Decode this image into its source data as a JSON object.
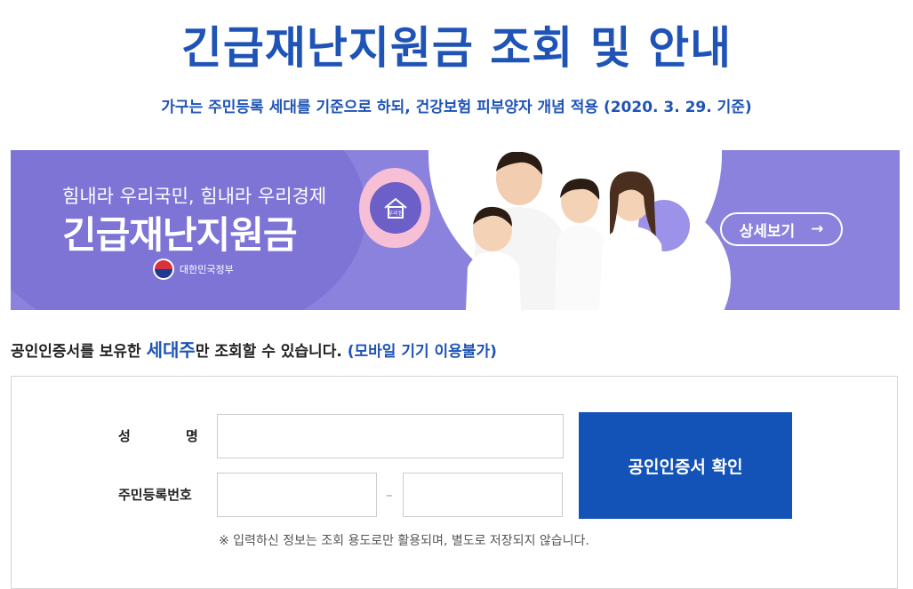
{
  "header": {
    "title": "긴급재난지원금 조회 및 안내",
    "subtitle": "가구는 주민등록 세대를 기준으로 하되, 건강보험 피부양자 개념 적용 (2020. 3. 29. 기준)"
  },
  "banner": {
    "slogan": "힘내라 우리국민, 힘내라 우리경제",
    "title": "긴급재난지원금",
    "gov_label": "대한민국정부",
    "detail_button": "상세보기",
    "detail_arrow": "→",
    "house_label": "우리집"
  },
  "notice": {
    "prefix": "공인인증서를 보유한 ",
    "highlight": "세대주",
    "middle": "만 조회할 수 있습니다. ",
    "mobile": "(모바일 기기 이용불가)"
  },
  "form": {
    "name_label_left": "성",
    "name_label_right": "명",
    "name_value": "",
    "rrn_label": "주민등록번호",
    "rrn_first_value": "",
    "rrn_second_value": "",
    "rrn_dash": "–",
    "submit_label": "공인인증서 확인",
    "hint": "※ 입력하신 정보는 조회 용도로만 활용되며, 별도로 저장되지 않습니다."
  },
  "colors": {
    "primary": "#1f54b6",
    "button": "#1352b6",
    "banner": "#8b82de",
    "pink": "#f6bfd6"
  }
}
